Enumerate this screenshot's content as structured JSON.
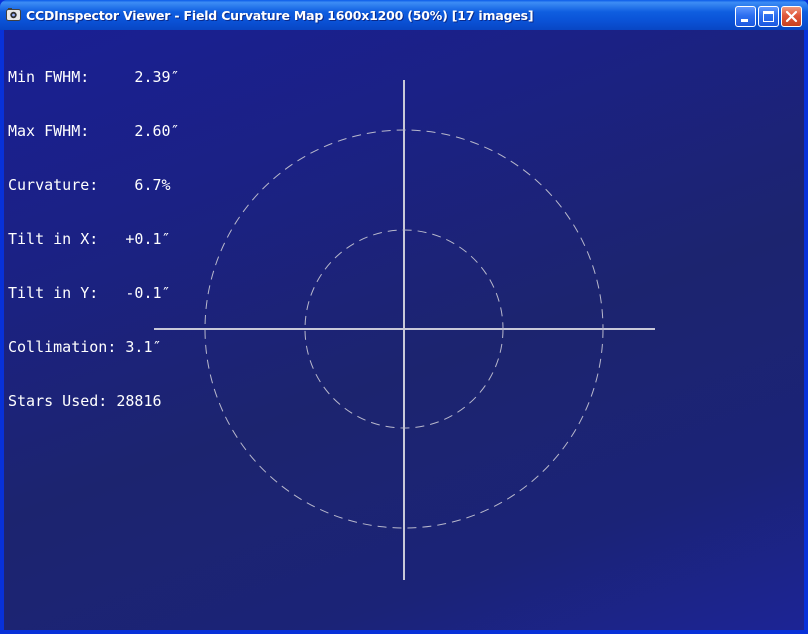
{
  "window": {
    "title": "CCDInspector Viewer - Field Curvature Map 1600x1200 (50%)  [17 images]",
    "app_icon": "ccdinspector-app-icon",
    "controls": {
      "minimize_icon": "minimize-icon",
      "maximize_icon": "maximize-icon",
      "close_icon": "close-icon"
    }
  },
  "stats": [
    {
      "label": "Min FWHM:",
      "value": "2.39″",
      "text": "Min FWHM:     2.39″"
    },
    {
      "label": "Max FWHM:",
      "value": "2.60″",
      "text": "Max FWHM:     2.60″"
    },
    {
      "label": "Curvature:",
      "value": "6.7%",
      "text": "Curvature:    6.7%"
    },
    {
      "label": "Tilt in X:",
      "value": "+0.1″",
      "text": "Tilt in X:   +0.1″"
    },
    {
      "label": "Tilt in Y:",
      "value": "-0.1″",
      "text": "Tilt in Y:   -0.1″"
    },
    {
      "label": "Collimation:",
      "value": "3.1″",
      "text": "Collimation: 3.1″"
    },
    {
      "label": "Stars Used:",
      "value": "28816",
      "text": "Stars Used: 28816"
    }
  ],
  "colors": {
    "title_bar": "#0a52d6",
    "background": "#1c246f",
    "map_lines": "#c8c8d8",
    "text": "#ffffff"
  }
}
